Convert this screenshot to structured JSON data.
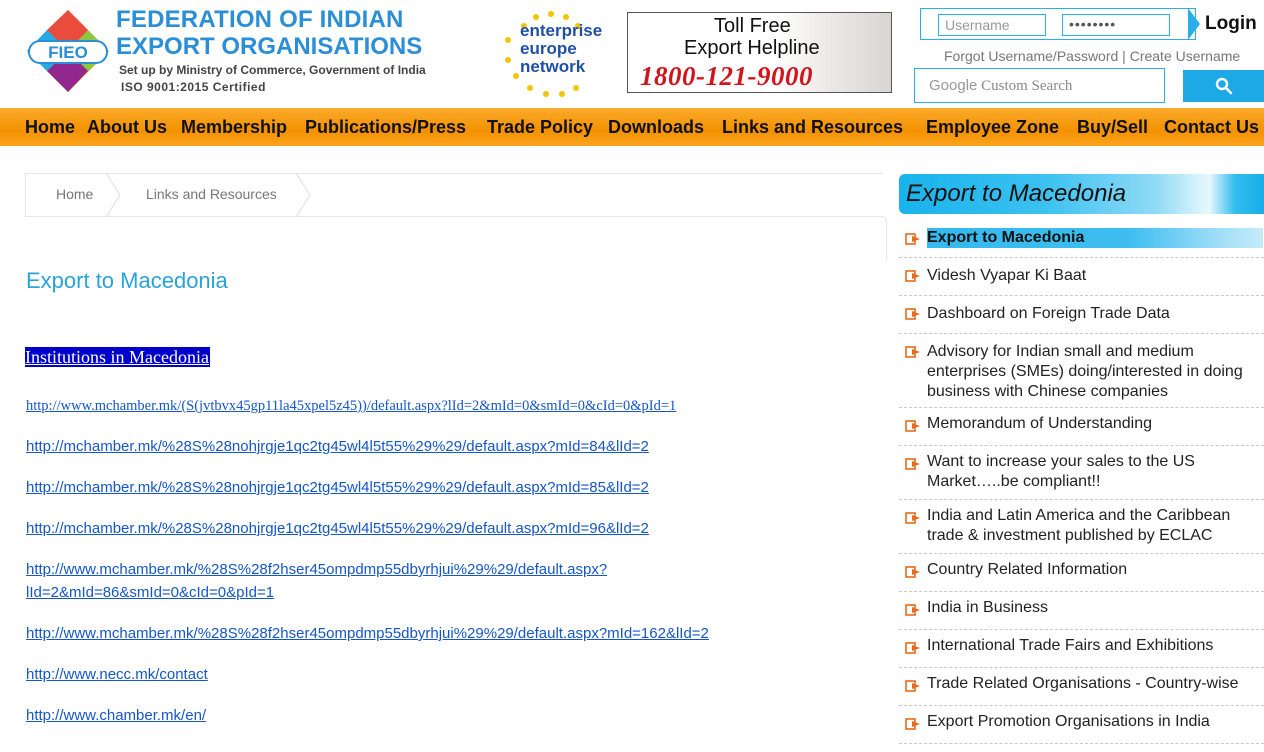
{
  "header": {
    "logo_badge": "FIEO",
    "logo_line1": "FEDERATION OF INDIAN",
    "logo_line2": "EXPORT ORGANISATIONS",
    "logo_sub": "Set up by Ministry of Commerce, Government of India",
    "logo_iso": "ISO 9001:2015 Certified",
    "een_line1": "enterprise",
    "een_line2": "europe",
    "een_line3": "network",
    "helpline_line1": "Toll Free",
    "helpline_line2": "Export Helpline",
    "helpline_number": "1800-121-9000",
    "username_placeholder": "Username",
    "password_value": "••••••••",
    "login_label": "Login",
    "forgot_text": "Forgot Username/Password | Create Username",
    "search_placeholder": "Custom Search",
    "search_brand": "Google"
  },
  "nav": {
    "items": [
      "Home",
      "About Us",
      "Membership",
      "Publications/Press",
      "Trade Policy",
      "Downloads",
      "Links and Resources",
      "Employee Zone",
      "Buy/Sell",
      "Contact Us"
    ]
  },
  "breadcrumb": {
    "items": [
      "Home",
      "Links and Resources"
    ]
  },
  "main": {
    "title": "Export to Macedonia",
    "section_heading": "Institutions in Macedonia",
    "links": [
      "http://www.mchamber.mk/(S(jvtbvx45gp11la45xpel5z45))/default.aspx?lId=2&mId=0&smId=0&cId=0&pId=1",
      "http://mchamber.mk/%28S%28nohjrgje1qc2tg45wl4l5t55%29%29/default.aspx?mId=84&lId=2",
      "http://mchamber.mk/%28S%28nohjrgje1qc2tg45wl4l5t55%29%29/default.aspx?mId=85&lId=2",
      "http://mchamber.mk/%28S%28nohjrgje1qc2tg45wl4l5t55%29%29/default.aspx?mId=96&lId=2",
      "http://www.mchamber.mk/%28S%28f2hser45ompdmp55dbyrhjui%29%29/default.aspx?",
      "lId=2&mId=86&smId=0&cId=0&pId=1",
      "http://www.mchamber.mk/%28S%28f2hser45ompdmp55dbyrhjui%29%29/default.aspx?mId=162&lId=2",
      "http://www.necc.mk/contact",
      "http://www.chamber.mk/en/"
    ]
  },
  "sidebar": {
    "title": "Export to Macedonia",
    "items": [
      "Export to Macedonia",
      "Videsh Vyapar Ki Baat",
      "Dashboard on Foreign Trade Data",
      "Advisory for Indian small and medium enterprises (SMEs) doing/interested in doing business with Chinese companies",
      "Memorandum of Understanding",
      "Want to increase your sales to the US Market…..be compliant!!",
      "India and Latin America and the Caribbean trade & investment published by ECLAC",
      "Country Related Information",
      "India in Business",
      "International Trade Fairs and Exhibitions",
      "Trade Related Organisations - Country-wise",
      "Export Promotion Organisations in India"
    ]
  },
  "colors": {
    "brand_blue": "#2a8fd6",
    "nav_orange": "#f39100",
    "accent_cyan": "#1da8e6",
    "link_blue": "#1556c8",
    "helpline_red": "#d0151d"
  }
}
